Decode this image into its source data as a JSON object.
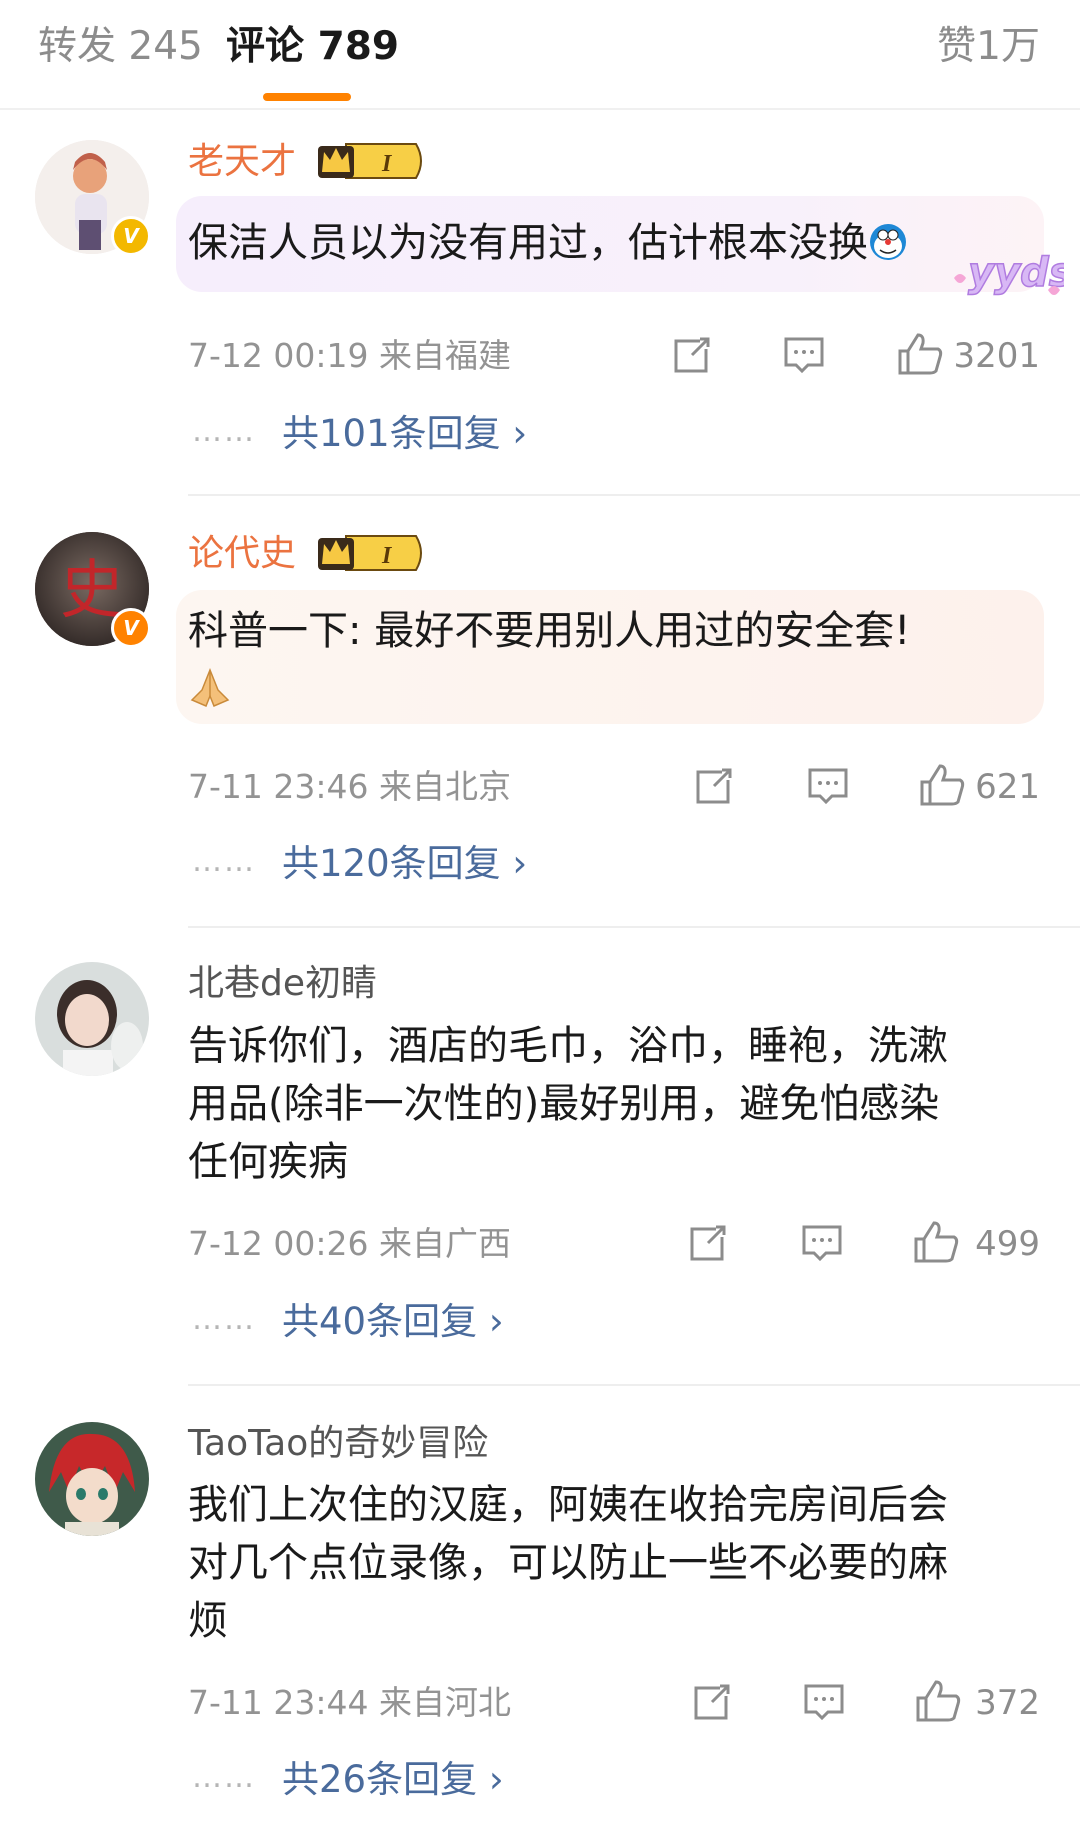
{
  "tabs": {
    "repost": "转发 245",
    "comment": "评论 789",
    "like": "赞1万"
  },
  "colors": {
    "accent": "#ff8200",
    "vip_name": "#eb7340",
    "reply_link": "#4a6b9c"
  },
  "comments": [
    {
      "username": "老天才",
      "badge": "crown-level-badge",
      "badge_level": "I",
      "text_lines": [
        "保洁人员以为没有用过，估计根本没换"
      ],
      "emoji": "doraemon-emoji",
      "sticker": "yyds",
      "time": "7-12 00:19",
      "location": "来自福建",
      "likes": "3201",
      "replies": "共101条回复",
      "reply_arrow": "›"
    },
    {
      "username": "论代史",
      "badge": "crown-level-badge",
      "badge_level": "I",
      "text_lines": [
        "科普一下: 最好不要用别人用过的安全套!"
      ],
      "emoji": "praying-hands-emoji",
      "time": "7-11 23:46",
      "location": "来自北京",
      "likes": "621",
      "replies": "共120条回复",
      "reply_arrow": "›"
    },
    {
      "username": "北巷de初睛",
      "text_lines": [
        "告诉你们，酒店的毛巾，浴巾，睡袍，洗漱",
        "用品(除非一次性的)最好别用，避免怕感染",
        "任何疾病"
      ],
      "time": "7-12 00:26",
      "location": "来自广西",
      "likes": "499",
      "replies": "共40条回复",
      "reply_arrow": "›"
    },
    {
      "username": "TaoTao的奇妙冒险",
      "text_lines": [
        "我们上次住的汉庭，阿姨在收拾完房间后会",
        "对几个点位录像，可以防止一些不必要的麻",
        "烦"
      ],
      "time": "7-11 23:44",
      "location": "来自河北",
      "likes": "372",
      "replies": "共26条回复",
      "reply_arrow": "›"
    }
  ],
  "dots": "……",
  "avatar_glyph_2": "史"
}
